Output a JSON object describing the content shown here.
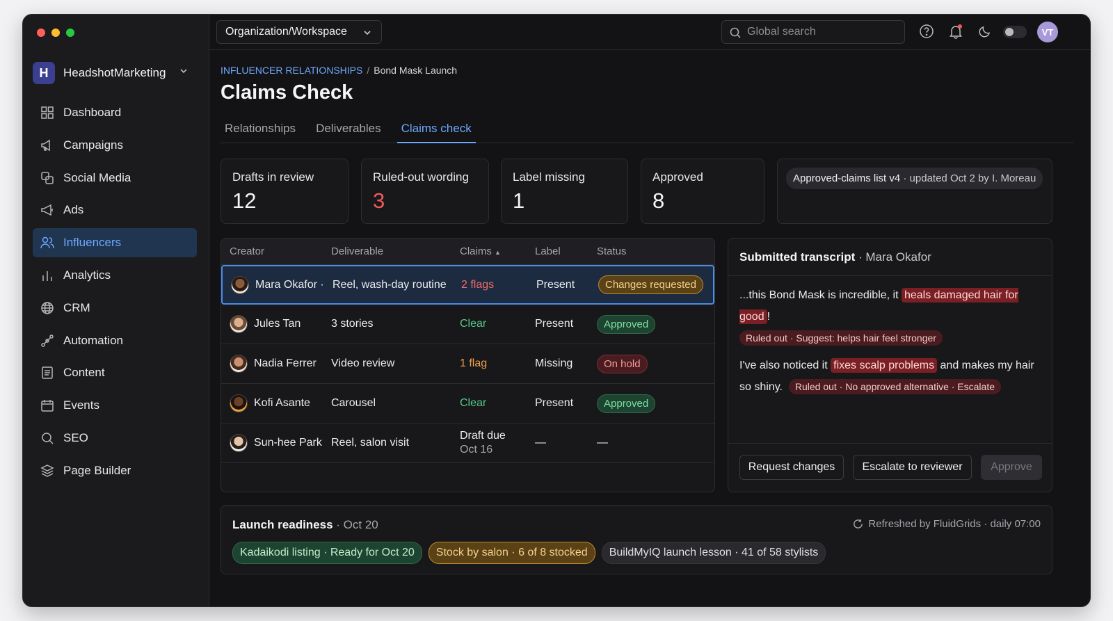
{
  "window": {
    "dot_colors": [
      "#ff5f57",
      "#febc2e",
      "#28c840"
    ]
  },
  "sidebar": {
    "workspace": {
      "logo": "H",
      "name": "HeadshotMarketing"
    },
    "items": [
      {
        "label": "Dashboard",
        "icon": "dashboard-icon"
      },
      {
        "label": "Campaigns",
        "icon": "megaphone-icon"
      },
      {
        "label": "Social Media",
        "icon": "social-icon"
      },
      {
        "label": "Ads",
        "icon": "ads-icon"
      },
      {
        "label": "Influencers",
        "icon": "users-icon",
        "active": true
      },
      {
        "label": "Analytics",
        "icon": "bar-chart-icon"
      },
      {
        "label": "CRM",
        "icon": "globe-icon"
      },
      {
        "label": "Automation",
        "icon": "automation-icon"
      },
      {
        "label": "Content",
        "icon": "document-icon"
      },
      {
        "label": "Events",
        "icon": "calendar-icon"
      },
      {
        "label": "SEO",
        "icon": "search-icon"
      },
      {
        "label": "Page Builder",
        "icon": "layers-icon"
      }
    ]
  },
  "topbar": {
    "org_selector": "Organization/Workspace",
    "search_placeholder": "Global search",
    "avatar": "VT"
  },
  "breadcrumb": {
    "parent": "INFLUENCER RELATIONSHIPS",
    "sep": "/",
    "current": "Bond Mask Launch"
  },
  "page_title": "Claims Check",
  "tabs": [
    "Relationships",
    "Deliverables",
    "Claims check"
  ],
  "kpis": [
    {
      "label": "Drafts in review",
      "value": "12"
    },
    {
      "label": "Ruled-out wording",
      "value": "3"
    },
    {
      "label": "Label missing",
      "value": "1"
    },
    {
      "label": "Approved",
      "value": "8"
    }
  ],
  "claims_list": {
    "name": "Approved-claims list v4",
    "meta": " · updated Oct 2 by I. Moreau"
  },
  "table": {
    "headers": [
      "Creator",
      "Deliverable",
      "Claims",
      "Label",
      "Status"
    ],
    "rows": [
      {
        "creator": "Mara Okafor ·",
        "deliverable": "Reel, wash-day routine",
        "claims": "2 flags",
        "label": "Present",
        "status": "Changes requested"
      },
      {
        "creator": "Jules Tan",
        "deliverable": "3 stories",
        "claims": "Clear",
        "label": "Present",
        "status": "Approved"
      },
      {
        "creator": "Nadia Ferrer",
        "deliverable": "Video review",
        "claims": "1 flag",
        "label": "Missing",
        "status": "On hold"
      },
      {
        "creator": "Kofi Asante",
        "deliverable": "Carousel",
        "claims": "Clear",
        "label": "Present",
        "status": "Approved"
      },
      {
        "creator": "Sun-hee Park",
        "deliverable": "Reel, salon visit",
        "claims": "Draft due",
        "claims2": "Oct 16",
        "label": "—",
        "status": "—"
      }
    ]
  },
  "transcript": {
    "title": "Submitted transcript",
    "creator": " · Mara Okafor",
    "p1_pre": "...this Bond Mask is incredible, it ",
    "p1_hl": "heals damaged hair for good",
    "p1_post": "!",
    "note1": "Ruled out · Suggest: helps hair feel stronger",
    "p2_pre": "I've also noticed it ",
    "p2_hl": "fixes scalp problems",
    "p2_post": " and makes my hair so shiny.",
    "note2": "Ruled out · No approved alternative · Escalate",
    "buttons": {
      "request": "Request changes",
      "escalate": "Escalate to reviewer",
      "approve": "Approve"
    }
  },
  "launch": {
    "title": "Launch readiness",
    "date": " · Oct 20",
    "refreshed": "Refreshed by FluidGrids · daily 07:00",
    "chips": [
      "Kadaikodi listing · Ready for Oct 20",
      "Stock by salon · 6 of 8 stocked",
      "BuildMyIQ launch lesson · 41 of 58 stylists"
    ]
  }
}
